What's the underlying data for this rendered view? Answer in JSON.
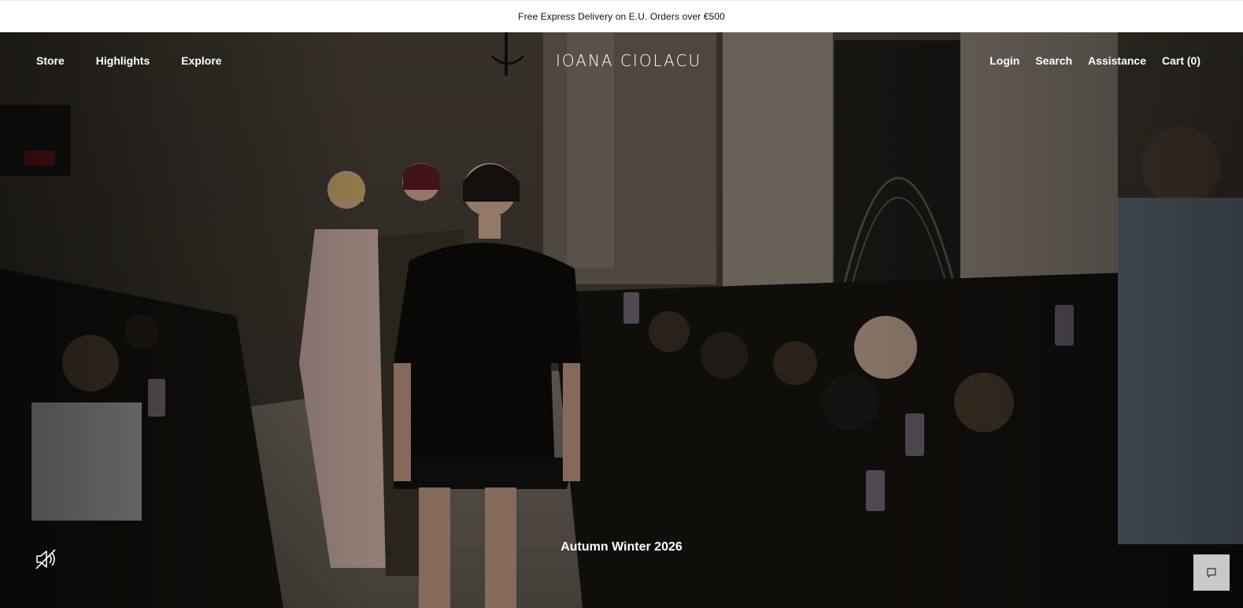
{
  "announcement": {
    "text": "Free Express Delivery on E.U. Orders over €500"
  },
  "header": {
    "logo_text": "IOANA CIOLACU",
    "nav_left": [
      {
        "label": "Store"
      },
      {
        "label": "Highlights"
      },
      {
        "label": "Explore"
      }
    ],
    "nav_right": [
      {
        "label": "Login"
      },
      {
        "label": "Search"
      },
      {
        "label": "Assistance"
      },
      {
        "label": "Cart (0)"
      }
    ]
  },
  "hero": {
    "collection_title": "Autumn Winter 2026",
    "mute_icon": "speaker-muted-icon",
    "chat_icon": "chat-bubble-icon"
  },
  "colors": {
    "announcement_bg": "#ffffff",
    "text_on_hero": "#ffffff",
    "chat_button_bg": "#c9c9c9"
  }
}
